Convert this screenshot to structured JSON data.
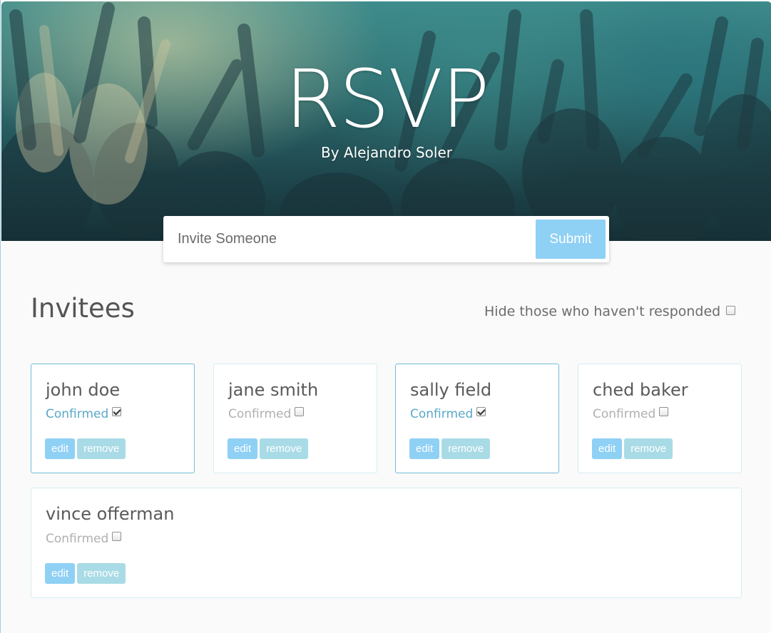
{
  "header": {
    "title": "RSVP",
    "subtitle": "By Alejandro Soler"
  },
  "invite": {
    "placeholder": "Invite Someone",
    "submit_label": "Submit"
  },
  "invitees": {
    "title": "Invitees",
    "hide_label": "Hide those who haven't responded",
    "hide_checked": false
  },
  "status_label": "Confirmed",
  "actions": {
    "edit_label": "edit",
    "remove_label": "remove"
  },
  "guests": [
    {
      "name": "john doe",
      "confirmed": true
    },
    {
      "name": "jane smith",
      "confirmed": false
    },
    {
      "name": "sally field",
      "confirmed": true
    },
    {
      "name": "ched baker",
      "confirmed": false
    },
    {
      "name": "vince offerman",
      "confirmed": false
    }
  ],
  "colors": {
    "accent": "#8fd0f5",
    "remove": "#a9dbe6",
    "confirmed_text": "#5aa8c8",
    "responded_border": "#76bcd8"
  }
}
